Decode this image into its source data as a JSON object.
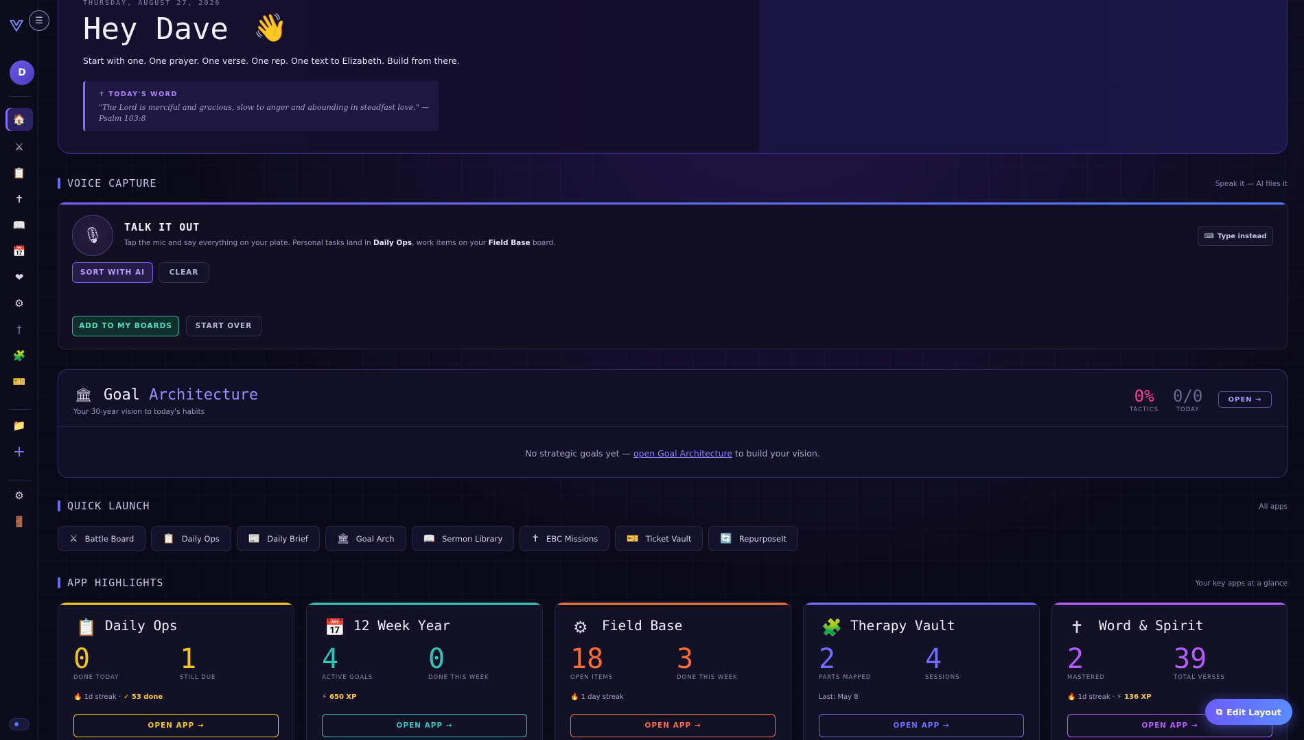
{
  "hero": {
    "date": "THURSDAY, AUGUST 27, 2026",
    "greeting": "Hey Dave",
    "wave": "👋",
    "subtitle": "Start with one. One prayer. One verse. One rep. One text to Elizabeth. Build from there.",
    "word_label": "TODAY'S WORD",
    "word_text": "\"The Lord is merciful and gracious, slow to anger and abounding in steadfast love.\" — Psalm 103:8"
  },
  "sidebar": {
    "avatar_initial": "D",
    "items": [
      {
        "icon": "home-icon",
        "glyph": "🏠",
        "active": true
      },
      {
        "icon": "swords-icon",
        "glyph": "⚔"
      },
      {
        "icon": "clipboard-icon",
        "glyph": "📋"
      },
      {
        "icon": "cross-icon",
        "glyph": "✝"
      },
      {
        "icon": "book-icon",
        "glyph": "📖"
      },
      {
        "icon": "calendar-icon",
        "glyph": "📅"
      },
      {
        "icon": "heart-icon",
        "glyph": "❤"
      },
      {
        "icon": "gear-icon",
        "glyph": "⚙"
      },
      {
        "icon": "small-cross-icon",
        "glyph": "†"
      },
      {
        "icon": "puzzle-icon",
        "glyph": "🧩"
      },
      {
        "icon": "ticket-icon",
        "glyph": "🎫"
      },
      {
        "icon": "folder-icon",
        "glyph": "📁"
      },
      {
        "icon": "plus-icon",
        "glyph": "+"
      },
      {
        "icon": "settings-icon",
        "glyph": "⚙"
      },
      {
        "icon": "door-icon",
        "glyph": "🚪"
      }
    ]
  },
  "voice": {
    "section_title": "VOICE CAPTURE",
    "section_right": "Speak it — AI files it",
    "title": "TALK IT OUT",
    "desc_a": "Tap the mic and say everything on your plate. Personal tasks land in ",
    "desc_b": "Daily Ops",
    "desc_c": ", work items on your ",
    "desc_d": "Field Base",
    "desc_e": " board.",
    "type_instead": "Type instead",
    "sort_btn": "SORT WITH AI",
    "clear_btn": "CLEAR",
    "add_btn": "ADD TO MY BOARDS",
    "start_over_btn": "START OVER"
  },
  "goal": {
    "title_a": "Goal",
    "title_b": "Architecture",
    "subtitle": "Your 30-year vision to today's habits",
    "tactics_value": "0%",
    "tactics_label": "TACTICS",
    "today_value": "0/0",
    "today_label": "TODAY",
    "open_btn": "OPEN →",
    "empty_a": "No strategic goals yet — ",
    "empty_link": "open Goal Architecture",
    "empty_b": " to build your vision."
  },
  "quick_launch": {
    "title": "QUICK LAUNCH",
    "right": "All apps",
    "items": [
      {
        "icon": "swords-icon",
        "glyph": "⚔",
        "label": "Battle Board"
      },
      {
        "icon": "clipboard-icon",
        "glyph": "📋",
        "label": "Daily Ops"
      },
      {
        "icon": "newspaper-icon",
        "glyph": "📰",
        "label": "Daily Brief"
      },
      {
        "icon": "building-icon",
        "glyph": "🏛",
        "label": "Goal Arch"
      },
      {
        "icon": "book-icon",
        "glyph": "📖",
        "label": "Sermon Library"
      },
      {
        "icon": "cross-icon",
        "glyph": "✝",
        "label": "EBC Missions"
      },
      {
        "icon": "ticket-icon",
        "glyph": "🎫",
        "label": "Ticket Vault"
      },
      {
        "icon": "repurpose-icon",
        "glyph": "🔄",
        "label": "RepurposeIt"
      }
    ]
  },
  "highlights": {
    "title": "APP HIGHLIGHTS",
    "right": "Your key apps at a glance",
    "cards": [
      {
        "icon": "clipboard-icon",
        "glyph": "📋",
        "name": "Daily Ops",
        "color": "#f5c518",
        "v1": "0",
        "l1": "DONE TODAY",
        "v2": "1",
        "l2": "STILL DUE",
        "extra_a": "🔥 1d streak ·",
        "extra_b": "✓ 53 done",
        "open": "OPEN APP →"
      },
      {
        "icon": "calendar-icon",
        "glyph": "📅",
        "name": "12 Week Year",
        "color": "#2ec4b6",
        "v1": "4",
        "l1": "ACTIVE GOALS",
        "v2": "0",
        "l2": "DONE THIS WEEK",
        "extra_a": "⚡",
        "extra_b": "650 XP",
        "open": "OPEN APP →"
      },
      {
        "icon": "gear-icon",
        "glyph": "⚙",
        "name": "Field Base",
        "color": "#ff6b35",
        "v1": "18",
        "l1": "OPEN ITEMS",
        "v2": "3",
        "l2": "DONE THIS WEEK",
        "extra_a": "🔥 1 day streak",
        "extra_b": "",
        "open": "OPEN APP →"
      },
      {
        "icon": "puzzle-icon",
        "glyph": "🧩",
        "name": "Therapy Vault",
        "color": "#6f6cff",
        "v1": "2",
        "l1": "PARTS MAPPED",
        "v2": "4",
        "l2": "SESSIONS",
        "extra_a": "Last: May 8",
        "extra_b": "",
        "open": "OPEN APP →"
      },
      {
        "icon": "cross-icon",
        "glyph": "✝",
        "name": "Word & Spirit",
        "color": "#b45cff",
        "v1": "2",
        "l1": "MASTERED",
        "v2": "39",
        "l2": "TOTAL VERSES",
        "extra_a": "🔥 1d streak · ⚡",
        "extra_b": "136 XP",
        "open": "OPEN APP →"
      }
    ]
  },
  "edit_layout": "Edit Layout"
}
